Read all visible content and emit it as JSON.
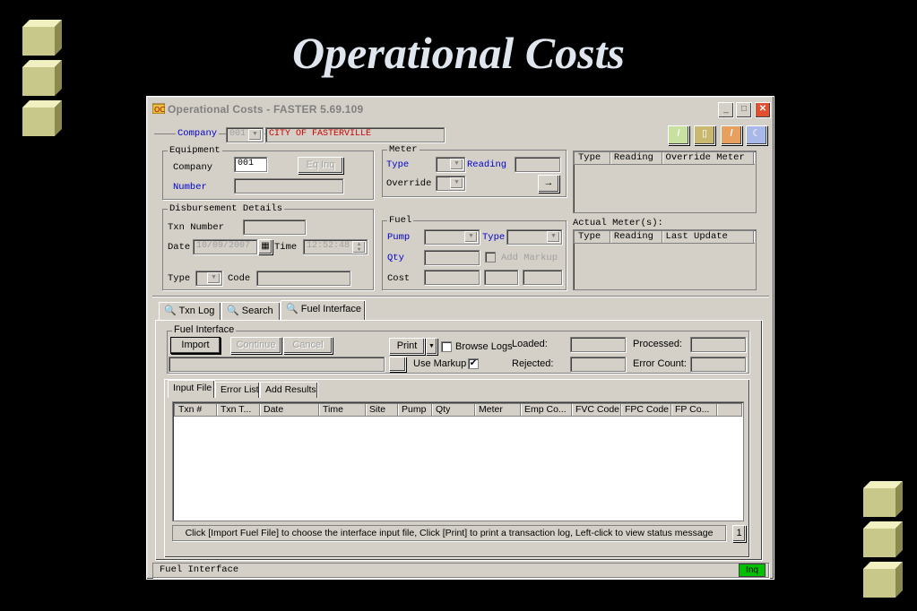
{
  "slide": {
    "title": "Operational Costs"
  },
  "window": {
    "title": "Operational Costs - FASTER 5.69.109"
  },
  "header": {
    "company_label": "Company",
    "company_code": "001",
    "company_name": "CITY OF FASTERVILLE"
  },
  "equipment": {
    "group_label": "Equipment",
    "company_label": "Company",
    "company_value": "001",
    "eq_inq_label": "Eq Inq",
    "number_label": "Number",
    "number_value": ""
  },
  "meter": {
    "group_label": "Meter",
    "type_label": "Type",
    "reading_label": "Reading",
    "override_label": "Override"
  },
  "meter_table": {
    "columns": [
      "Type",
      "Reading",
      "Override Meter"
    ]
  },
  "actual_meters": {
    "label": "Actual Meter(s):",
    "columns": [
      "Type",
      "Reading",
      "Last Update"
    ]
  },
  "disbursement": {
    "group_label": "Disbursement Details",
    "txn_number_label": "Txn Number",
    "date_label": "Date",
    "date_value": "10/09/2007",
    "time_label": "Time",
    "time_value": "12:52:48",
    "type_label": "Type",
    "code_label": "Code"
  },
  "fuel": {
    "group_label": "Fuel",
    "pump_label": "Pump",
    "type_label": "Type",
    "qty_label": "Qty",
    "add_markup_label": "Add Markup",
    "cost_label": "Cost"
  },
  "main_tabs": [
    "Txn Log",
    "Search",
    "Fuel Interface"
  ],
  "fuel_interface": {
    "group_label": "Fuel Interface",
    "import_label": "Import",
    "continue_label": "Continue",
    "cancel_label": "Cancel",
    "print_label": "Print",
    "browse_logs_label": "Browse Logs",
    "use_markup_label": "Use Markup",
    "loaded_label": "Loaded:",
    "rejected_label": "Rejected:",
    "processed_label": "Processed:",
    "error_count_label": "Error Count:"
  },
  "sub_tabs": [
    "Input File",
    "Error List",
    "Add Results"
  ],
  "grid": {
    "columns": [
      "Txn #",
      "Txn T...",
      "Date",
      "Time",
      "Site",
      "Pump",
      "Qty",
      "Meter",
      "Emp Co...",
      "FVC Code",
      "FPC Code",
      "FP Co..."
    ]
  },
  "hint": {
    "text": "Click [Import Fuel File] to choose the interface input file,  Click [Print] to print a transaction log, Left-click to view status message",
    "page": "1"
  },
  "statusbar": {
    "text": "Fuel Interface",
    "mode": "Inq"
  },
  "colors": {
    "status_green": "#00c000",
    "link_blue": "#0000cc",
    "company_red": "#cc0000"
  }
}
